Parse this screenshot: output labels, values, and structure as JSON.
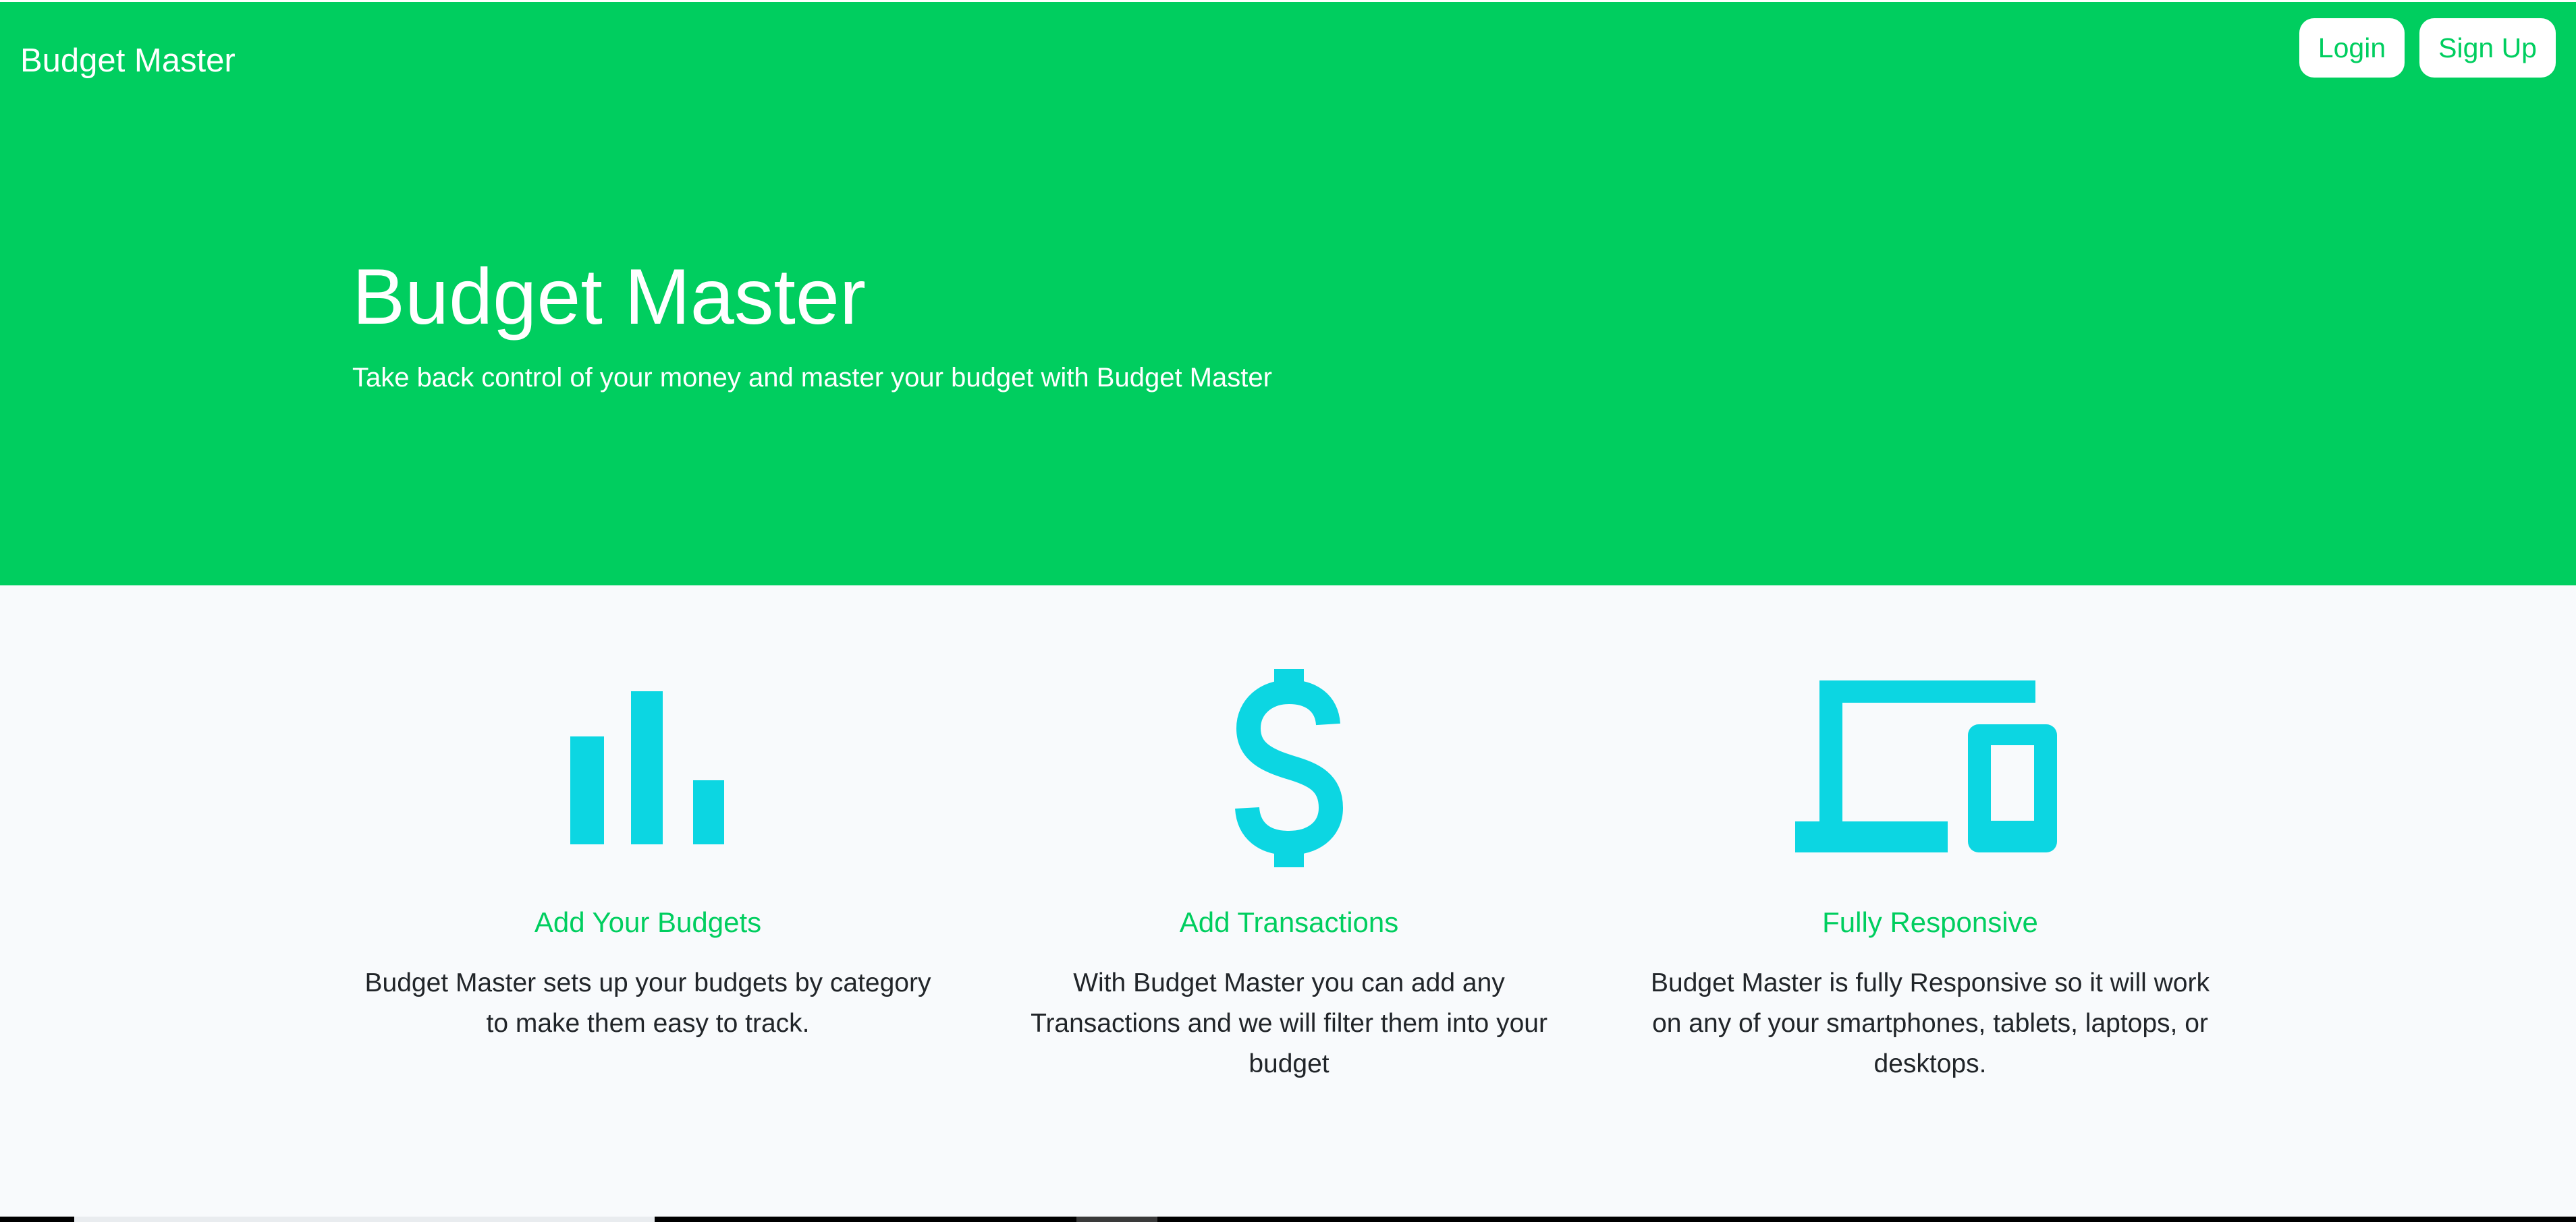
{
  "navbar": {
    "brand": "Budget Master",
    "login_label": "Login",
    "signup_label": "Sign Up"
  },
  "hero": {
    "title": "Budget Master",
    "subtitle": "Take back control of your money and master your budget with Budget Master"
  },
  "features": [
    {
      "icon": "bar-chart-icon",
      "title": "Add Your Budgets",
      "text": "Budget Master sets up your budgets by category to make them easy to track."
    },
    {
      "icon": "dollar-sign-icon",
      "title": "Add Transactions",
      "text": "With Budget Master you can add any Transactions and we will filter them into your budget"
    },
    {
      "icon": "devices-icon",
      "title": "Fully Responsive",
      "text": "Budget Master is fully Responsive so it will work on any of your smartphones, tablets, laptops, or desktops."
    }
  ],
  "colors": {
    "brand_green": "#00ce5f",
    "icon_cyan": "#0cd6e2",
    "page_background": "#f8fafc",
    "body_text": "#212529"
  }
}
